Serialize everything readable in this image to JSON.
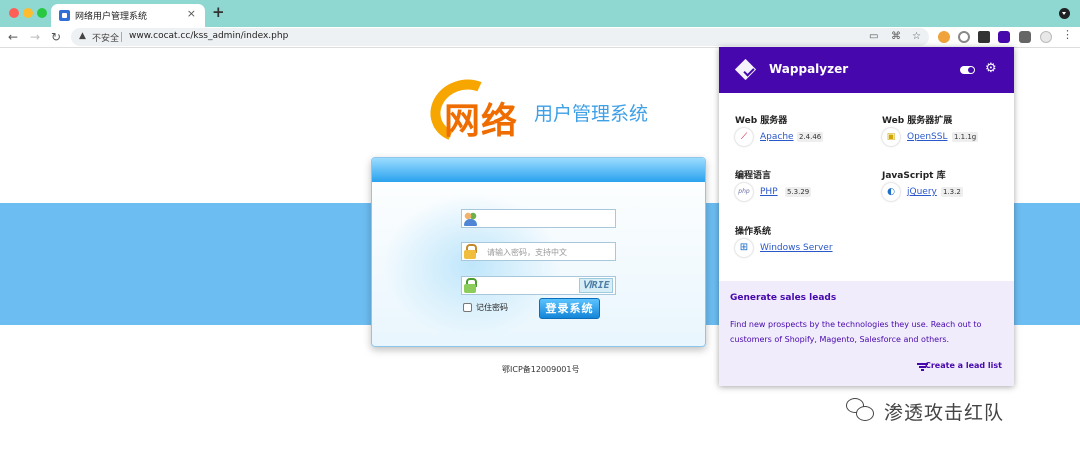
{
  "browser": {
    "tab_title": "网络用户管理系统",
    "tab_close": "×",
    "new_tab": "+",
    "nav_back": "←",
    "nav_forward": "→",
    "nav_reload": "↻",
    "insecure_label": "不安全",
    "url": "www.cocat.cc/kss_admin/index.php"
  },
  "page": {
    "logo_big": "网络",
    "logo_small": "用户管理系统",
    "password_placeholder": "请输入密码，支持中文",
    "captcha": "ⅥRIE",
    "remember_label": "记住密码",
    "login_button": "登录系统",
    "icp": "鄂ICP备12009001号"
  },
  "wappalyzer": {
    "title": "Wappalyzer",
    "gear": "⚙",
    "categories": [
      {
        "title": "Web 服务器",
        "tech": "Apache",
        "version": "2.4.46",
        "icon": "apache-feather-icon"
      },
      {
        "title": "Web 服务器扩展",
        "tech": "OpenSSL",
        "version": "1.1.1g",
        "icon": "openssl-lock-icon"
      },
      {
        "title": "编程语言",
        "tech": "PHP",
        "version": "5.3.29",
        "icon": "php-icon"
      },
      {
        "title": "JavaScript 库",
        "tech": "jQuery",
        "version": "1.3.2",
        "icon": "jquery-icon"
      },
      {
        "title": "操作系统",
        "tech": "Windows Server",
        "version": "",
        "icon": "windows-icon"
      }
    ],
    "lead_title": "Generate sales leads",
    "lead_text": "Find new prospects by the technologies they use. Reach out to customers of Shopify, Magento, Salesforce and others.",
    "lead_link": "Create a lead list"
  },
  "watermark": {
    "text": "渗透攻击红队"
  },
  "colors": {
    "wappalyzer_purple": "#4608ad",
    "page_band": "#6cbdf2",
    "tab_bar": "#8fd8d2"
  }
}
